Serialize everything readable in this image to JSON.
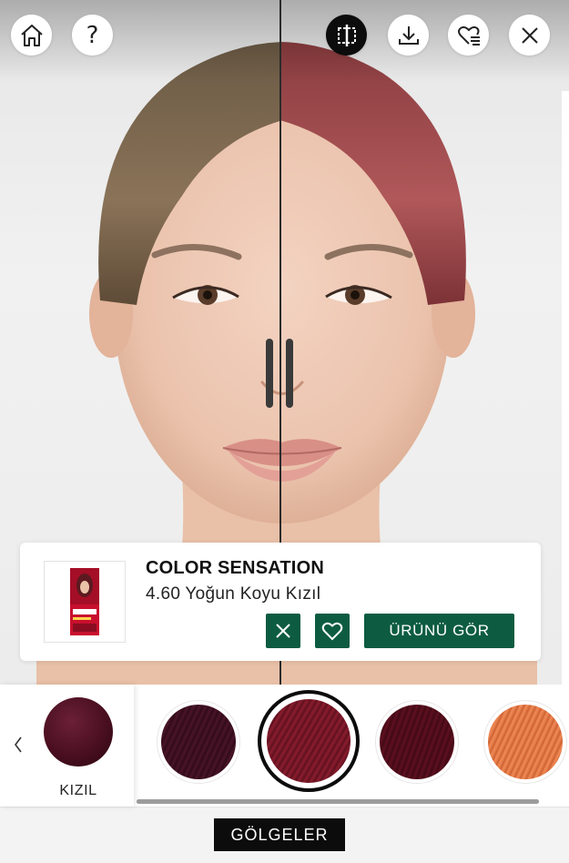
{
  "toolbar": {
    "home": {
      "icon": "home-icon"
    },
    "help": {
      "icon": "question-mark-icon"
    },
    "compare": {
      "icon": "split-compare-icon",
      "active": true
    },
    "download": {
      "icon": "download-icon"
    },
    "favorites": {
      "icon": "heart-list-icon"
    },
    "close": {
      "icon": "close-icon"
    }
  },
  "product": {
    "name": "COLOR SENSATION",
    "shade": "4.60 Yoğun Koyu Kızıl",
    "remove_icon": "close-icon",
    "favorite_icon": "heart-outline-icon",
    "view_button": "ÜRÜNÜ GÖR",
    "accent_color": "#0d5c41"
  },
  "shade_family": {
    "label": "KIZIL",
    "color": "#4a0f20",
    "prev_icon": "chevron-left-icon"
  },
  "shades": [
    {
      "color": "#3b0d1c",
      "selected": false
    },
    {
      "color": "#6e1423",
      "selected": true
    },
    {
      "color": "#4c0a16",
      "selected": false
    },
    {
      "color": "#d8703f",
      "selected": false
    }
  ],
  "footer": {
    "shades_button": "GÖLGELER"
  }
}
